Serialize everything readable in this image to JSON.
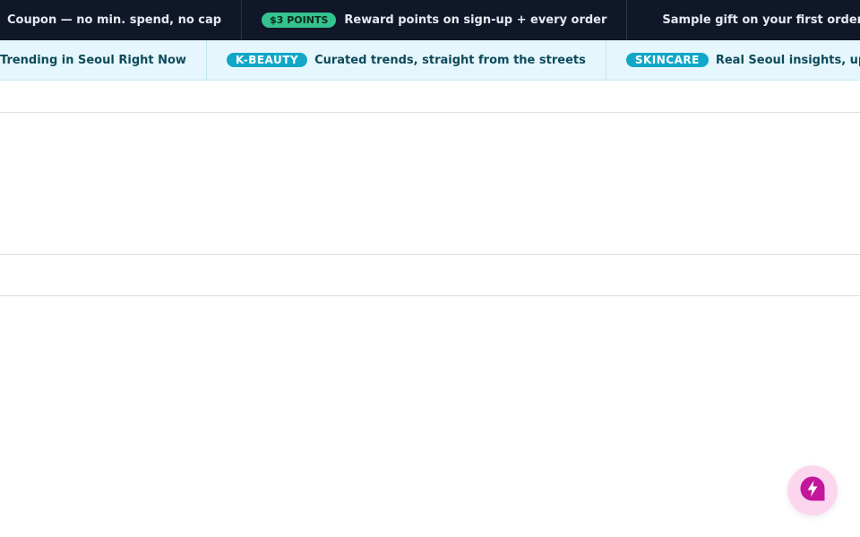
{
  "promo": {
    "items": [
      {
        "text": "Coupon — no min. spend, no cap"
      },
      {
        "badge": "$3 POINTS",
        "text": "Reward points on sign-up + every order"
      },
      {
        "icon": "gift-icon",
        "text": "Sample gift on your first order"
      }
    ]
  },
  "trends": {
    "items": [
      {
        "text": "Trending in Seoul Right Now"
      },
      {
        "badge": "K-BEAUTY",
        "text": "Curated trends, straight from the streets"
      },
      {
        "badge": "SKINCARE",
        "text": "Real Seoul insights, updated"
      }
    ]
  },
  "chat_button": {
    "icon": "lightning-chat-icon"
  },
  "colors": {
    "promo_bg": "#0f1729",
    "points_badge": "#34c38f",
    "trend_bg": "#e5f7fc",
    "tag_badge": "#12a7c8",
    "fab_bg": "#fcd6ef",
    "fab_icon": "#c2169b"
  }
}
